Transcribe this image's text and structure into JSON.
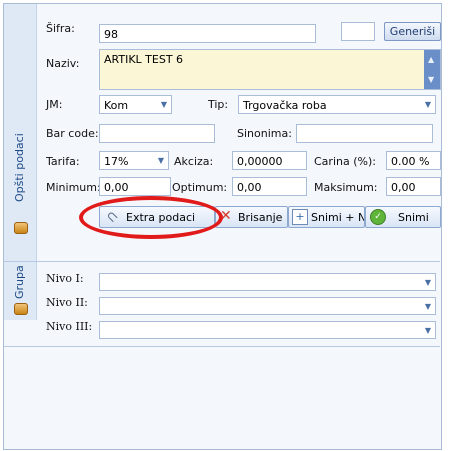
{
  "tabs": {
    "general": "Opšti podaci",
    "group": "Grupa"
  },
  "sifra": {
    "label": "Šifra:",
    "value": "98",
    "extra_value": ""
  },
  "generate_label": "Generiši",
  "naziv": {
    "label": "Naziv:",
    "value": "ARTIKL TEST 6"
  },
  "jm": {
    "label": "JM:",
    "value": "Kom"
  },
  "tip": {
    "label": "Tip:",
    "value": "Trgovačka roba"
  },
  "barcode": {
    "label": "Bar code:",
    "value": ""
  },
  "sinonima": {
    "label": "Sinonima:",
    "value": ""
  },
  "tarifa": {
    "label": "Tarifa:",
    "value": "17%"
  },
  "akciza": {
    "label": "Akciza:",
    "value": "0,00000"
  },
  "carina": {
    "label": "Carina (%):",
    "value": "0.00 %"
  },
  "minimum": {
    "label": "Minimum:",
    "value": "0,00"
  },
  "optimum": {
    "label": "Optimum:",
    "value": "0,00"
  },
  "maksimum": {
    "label": "Maksimum:",
    "value": "0,00"
  },
  "buttons": {
    "extra": "Extra podaci",
    "delete": "Brisanje",
    "save_new": "Snimi + Novi",
    "save": "Snimi"
  },
  "nivo": [
    {
      "label": "Nivo I:",
      "value": ""
    },
    {
      "label": "Nivo II:",
      "value": ""
    },
    {
      "label": "Nivo III:",
      "value": ""
    }
  ],
  "colors": {
    "highlight_ring": "#e11a1a",
    "accent": "#1e4b86",
    "memo_bg": "#fbf7d6"
  }
}
